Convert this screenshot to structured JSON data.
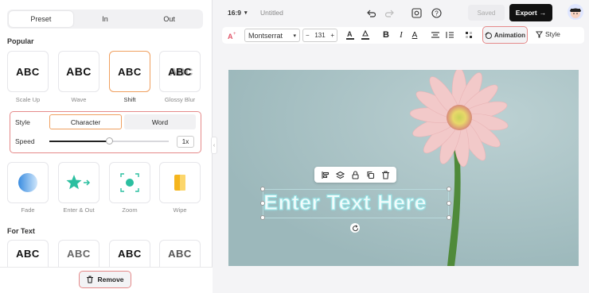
{
  "left_panel": {
    "tabs": [
      {
        "label": "Preset"
      },
      {
        "label": "In"
      },
      {
        "label": "Out"
      }
    ],
    "active_tab": "Preset",
    "sections": {
      "popular": "Popular",
      "for_text": "For Text"
    },
    "popular_cards": [
      {
        "text": "ABC",
        "label": "Scale Up"
      },
      {
        "text": "ABC",
        "label": "Wave"
      },
      {
        "text": "ABC",
        "label": "Shift",
        "selected": true
      },
      {
        "text": "ABC",
        "label": "Glossy Blur"
      }
    ],
    "style_label": "Style",
    "style_options": [
      {
        "label": "Character",
        "selected": true
      },
      {
        "label": "Word"
      }
    ],
    "speed_label": "Speed",
    "speed_value": "1x",
    "speed_fraction": 0.5,
    "effect_cards": [
      {
        "label": "Fade",
        "icon": "fade-icon"
      },
      {
        "label": "Enter & Out",
        "icon": "star-arrow-icon"
      },
      {
        "label": "Zoom",
        "icon": "zoom-icon"
      },
      {
        "label": "Wipe",
        "icon": "wipe-icon"
      }
    ],
    "text_cards": [
      {
        "text": "ABC"
      },
      {
        "text": "ABC"
      },
      {
        "text": "ABC"
      },
      {
        "text": "ABC"
      }
    ],
    "remove_label": "Remove"
  },
  "header": {
    "aspect": "16:9",
    "title": "Untitled",
    "saved": "Saved",
    "export": "Export"
  },
  "toolbar": {
    "font": "Montserrat",
    "size": "131",
    "animation": "Animation",
    "style": "Style"
  },
  "canvas": {
    "text": "Enter Text Here",
    "bg_color": "#a7c1c4"
  }
}
